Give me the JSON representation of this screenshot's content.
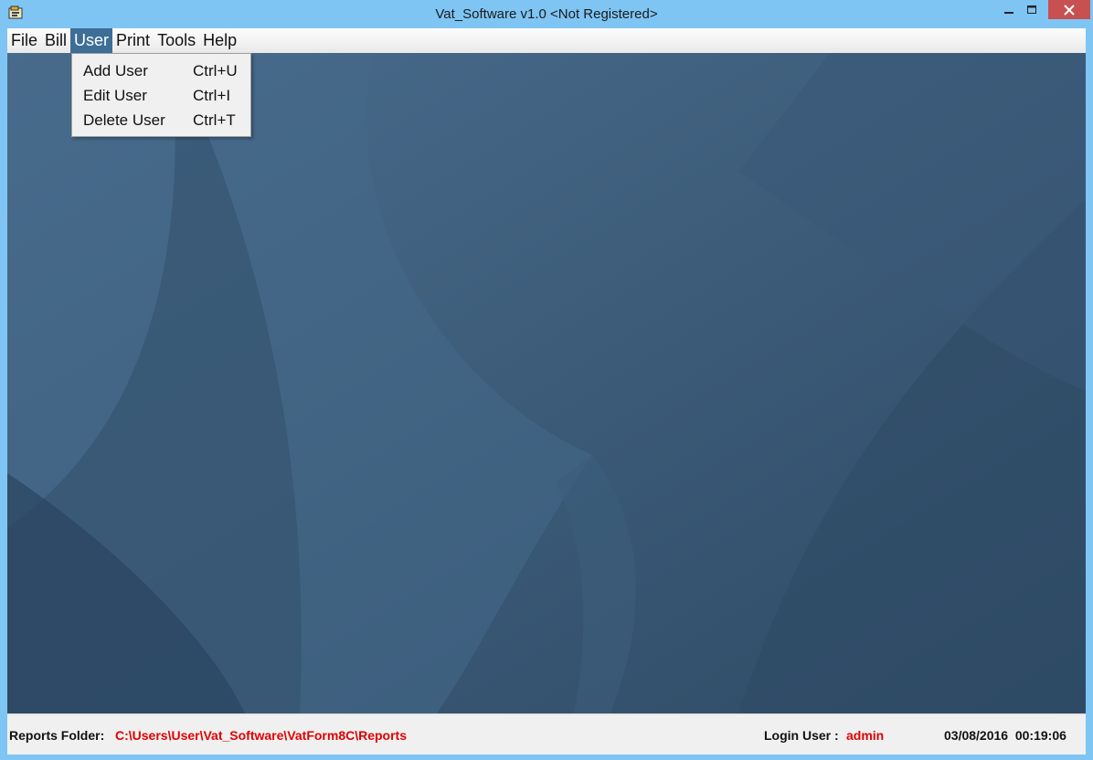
{
  "window": {
    "title": "Vat_Software v1.0 <Not Registered>",
    "accent_color": "#7fc5f4",
    "close_color": "#c75050"
  },
  "menubar": {
    "items": [
      {
        "label": "File"
      },
      {
        "label": "Bill"
      },
      {
        "label": "User"
      },
      {
        "label": "Print"
      },
      {
        "label": "Tools"
      },
      {
        "label": "Help"
      }
    ],
    "active": "User"
  },
  "user_menu": {
    "items": [
      {
        "label": "Add User",
        "shortcut": "Ctrl+U"
      },
      {
        "label": "Edit User",
        "shortcut": "Ctrl+I"
      },
      {
        "label": "Delete User",
        "shortcut": "Ctrl+T"
      }
    ]
  },
  "statusbar": {
    "reports_label": "Reports Folder:",
    "reports_value": "C:\\Users\\User\\Vat_Software\\VatForm8C\\Reports",
    "login_label": "Login User :",
    "login_value": "admin",
    "datetime": "03/08/2016  00:19:06",
    "highlight_color": "#e00000"
  },
  "icons": [
    "app-icon",
    "minimize-icon",
    "maximize-icon",
    "close-icon"
  ]
}
